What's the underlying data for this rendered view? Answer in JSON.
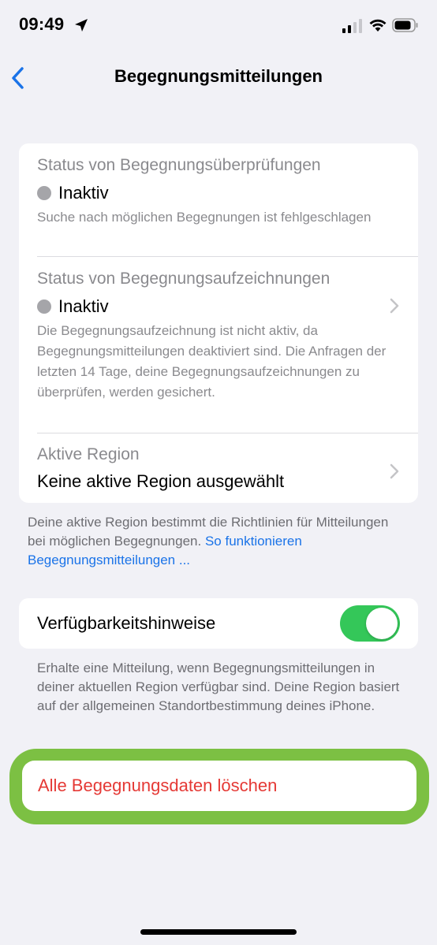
{
  "status_bar": {
    "time": "09:49",
    "icons": [
      "location-arrow-icon",
      "cellular-signal-icon",
      "wifi-icon",
      "battery-icon"
    ]
  },
  "nav": {
    "back_icon": "chevron-left-icon",
    "title": "Begegnungsmitteilungen"
  },
  "status_card": {
    "checks": {
      "label": "Status von Begegnungsüberprüfungen",
      "status": "Inaktiv",
      "description": "Suche nach möglichen Begegnungen ist fehlgeschlagen"
    },
    "recordings": {
      "label": "Status von Begegnungsaufzeichnungen",
      "status": "Inaktiv",
      "description": "Die Begegnungsaufzeichnung ist nicht aktiv, da Begegnungsmitteilungen deaktiviert sind. Die Anfragen der letzten 14 Tage, deine Begegnungsaufzeichnungen zu überprüfen, werden gesichert."
    },
    "region": {
      "label": "Aktive Region",
      "value": "Keine aktive Region ausgewählt"
    }
  },
  "region_footnote": {
    "text": "Deine aktive Region bestimmt die Richtlinien für Mitteilungen bei möglichen Begegnungen. ",
    "link": "So funktionieren Begegnungsmitteilungen ..."
  },
  "availability": {
    "label": "Verfügbarkeitshinweise",
    "enabled": true,
    "toggle_color": "#34c759",
    "footnote": "Erhalte eine Mitteilung, wenn Begegnungsmitteilungen in deiner aktuellen Region verfügbar sind. Deine Region basiert auf der allgemeinen Standortbestimmung deines iPhone."
  },
  "delete": {
    "label": "Alle Begegnungsdaten löschen",
    "label_color": "#e53935",
    "highlight_color": "#7cc043"
  },
  "colors": {
    "background": "#f1f1f6",
    "accent": "#1a73e8"
  }
}
